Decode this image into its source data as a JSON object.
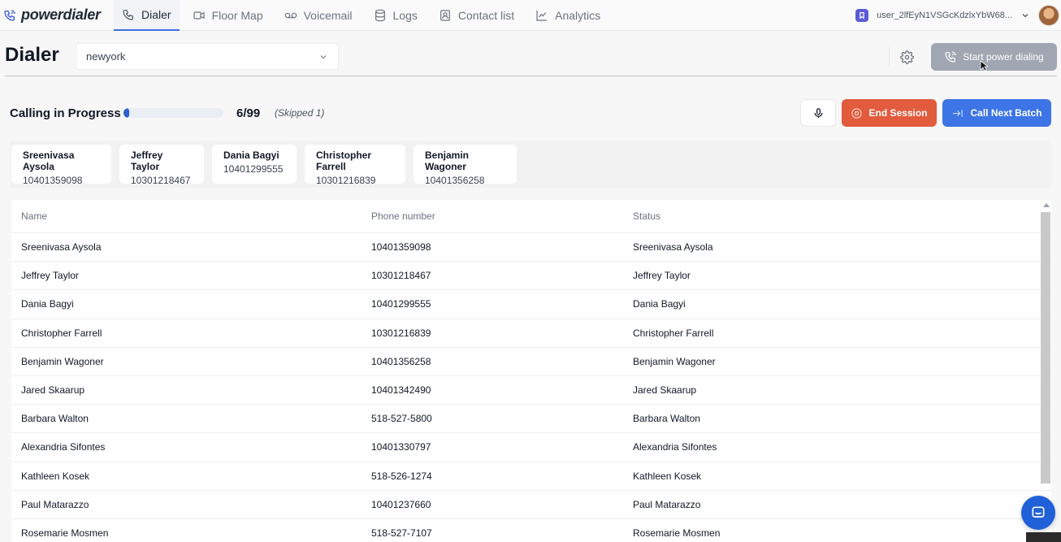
{
  "brand": {
    "name": "powerdialer"
  },
  "nav": {
    "tabs": [
      {
        "label": "Dialer",
        "icon": "phone-icon",
        "active": true
      },
      {
        "label": "Floor Map",
        "icon": "video-icon",
        "active": false
      },
      {
        "label": "Voicemail",
        "icon": "voicemail-icon",
        "active": false
      },
      {
        "label": "Logs",
        "icon": "database-icon",
        "active": false
      },
      {
        "label": "Contact list",
        "icon": "contact-book-icon",
        "active": false
      },
      {
        "label": "Analytics",
        "icon": "chart-icon",
        "active": false
      }
    ],
    "user": "user_2lfEyN1VSGcKdzlxYbW68..."
  },
  "header": {
    "title": "Dialer",
    "region": "newyork",
    "start_button": "Start power dialing"
  },
  "session": {
    "label": "Calling in Progress",
    "progress_fraction": 0.06,
    "count": "6/99",
    "skipped": "(Skipped 1)",
    "end_button": "End Session",
    "next_button": "Call Next Batch"
  },
  "active_calls": [
    {
      "name": "Sreenivasa Aysola",
      "phone": "10401359098"
    },
    {
      "name": "Jeffrey Taylor",
      "phone": "10301218467"
    },
    {
      "name": "Dania Bagyi",
      "phone": "10401299555"
    },
    {
      "name": "Christopher Farrell",
      "phone": "10301216839"
    },
    {
      "name": "Benjamin Wagoner",
      "phone": "10401356258"
    }
  ],
  "table": {
    "columns": [
      "Name",
      "Phone number",
      "Status"
    ],
    "rows": [
      [
        "Sreenivasa Aysola",
        "10401359098",
        "Sreenivasa Aysola"
      ],
      [
        "Jeffrey Taylor",
        "10301218467",
        "Jeffrey Taylor"
      ],
      [
        "Dania Bagyi",
        "10401299555",
        "Dania Bagyi"
      ],
      [
        "Christopher Farrell",
        "10301216839",
        "Christopher Farrell"
      ],
      [
        "Benjamin Wagoner",
        "10401356258",
        "Benjamin Wagoner"
      ],
      [
        "Jared Skaarup",
        "10401342490",
        "Jared Skaarup"
      ],
      [
        "Barbara Walton",
        "518-527-5800",
        "Barbara Walton"
      ],
      [
        "Alexandria Sifontes",
        "10401330797",
        "Alexandria Sifontes"
      ],
      [
        "Kathleen Kosek",
        "518-526-1274",
        "Kathleen Kosek"
      ],
      [
        "Paul Matarazzo",
        "10401237660",
        "Paul Matarazzo"
      ],
      [
        "Rosemarie Mosmen",
        "518-527-7107",
        "Rosemarie Mosmen"
      ]
    ]
  },
  "colors": {
    "accent": "#3d74e6",
    "danger": "#e25b3d",
    "disabled": "#9ca3af"
  }
}
